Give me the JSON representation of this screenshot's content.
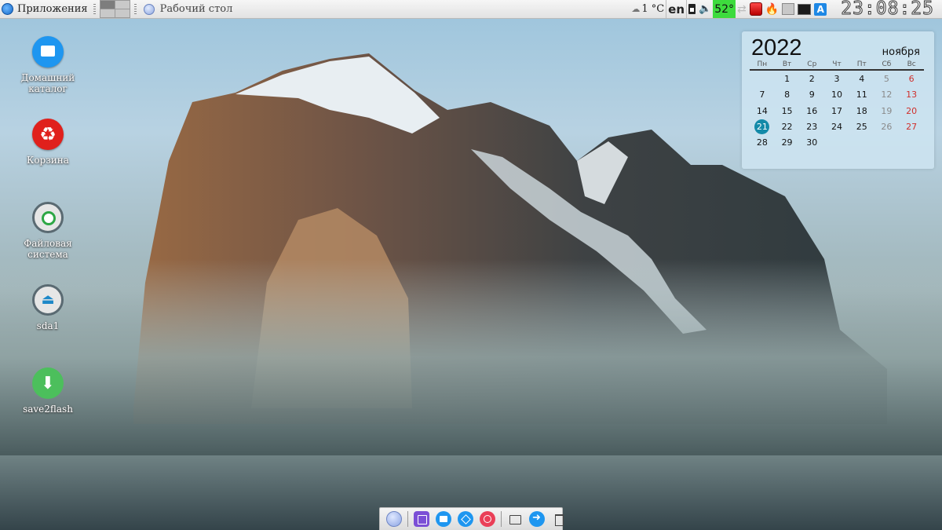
{
  "top_panel": {
    "apps_label": "Приложения",
    "desktop_label": "Рабочий стол",
    "tray": {
      "weather": "1 °C",
      "language": "en",
      "cpu_temp": "52°",
      "clock": "23:08:25"
    }
  },
  "desktop_icons": [
    {
      "label": "Домашний каталог",
      "icon": "home-folder-icon"
    },
    {
      "label": "Корзина",
      "icon": "trash-icon"
    },
    {
      "label": "Файловая система",
      "icon": "filesystem-icon"
    },
    {
      "label": "sda1",
      "icon": "eject-drive-icon"
    },
    {
      "label": "save2flash",
      "icon": "download-icon"
    }
  ],
  "calendar": {
    "year": "2022",
    "month": "ноября",
    "weekdays": [
      "Пн",
      "Вт",
      "Ср",
      "Чт",
      "Пт",
      "Сб",
      "Вс"
    ],
    "days": [
      "",
      "1",
      "2",
      "3",
      "4",
      "5",
      "6",
      "7",
      "8",
      "9",
      "10",
      "11",
      "12",
      "13",
      "14",
      "15",
      "16",
      "17",
      "18",
      "19",
      "20",
      "21",
      "22",
      "23",
      "24",
      "25",
      "26",
      "27",
      "28",
      "29",
      "30",
      "",
      "",
      "",
      ""
    ],
    "today": "21"
  },
  "dock": [
    {
      "icon": "menu-ball-icon"
    },
    {
      "icon": "terminal-icon"
    },
    {
      "icon": "file-manager-icon"
    },
    {
      "icon": "browser-icon"
    },
    {
      "icon": "disk-usage-icon"
    },
    {
      "icon": "folder-icon"
    },
    {
      "icon": "share-icon"
    },
    {
      "icon": "trash-can-icon"
    }
  ],
  "colors": {
    "accent": "#1e96f0",
    "today_highlight": "#138aa8",
    "sunday": "#d0302c",
    "temp_badge": "#3ddb3d"
  }
}
